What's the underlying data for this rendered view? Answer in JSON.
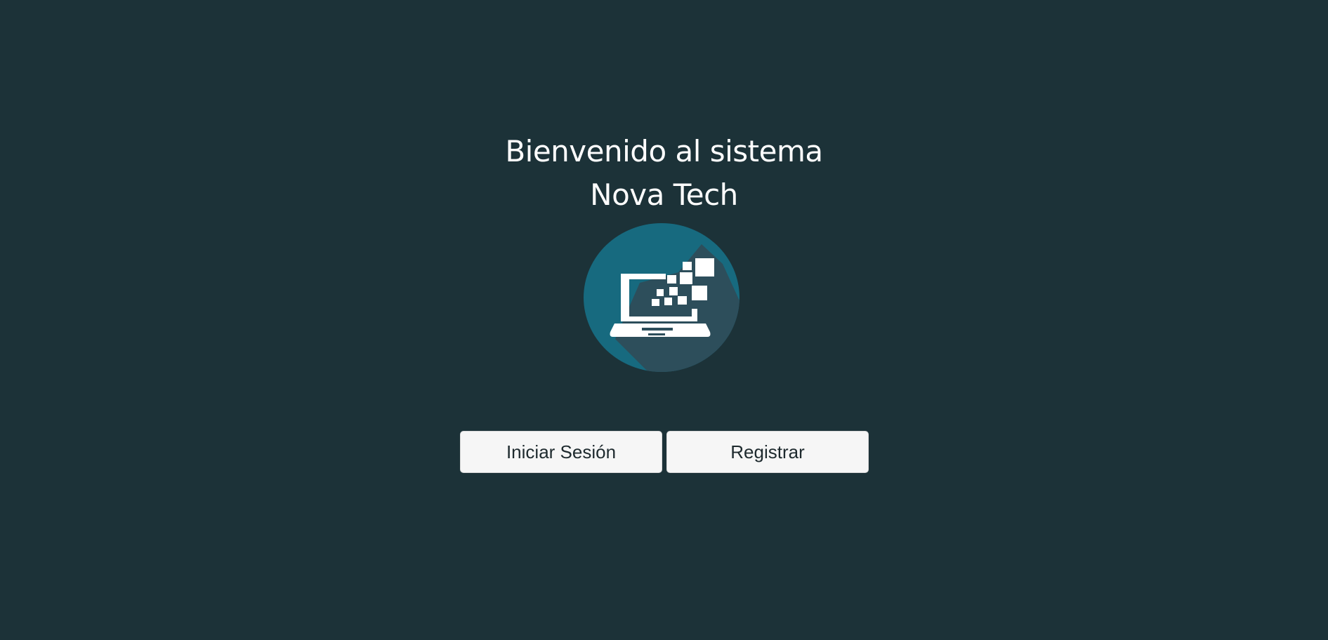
{
  "welcome": {
    "line1": "Bienvenido al sistema",
    "line2": "Nova Tech"
  },
  "logo": {
    "icon": "laptop-pixels-icon",
    "circle_color": "#176a7f",
    "shadow_color": "#2d4e5b",
    "glyph_color": "#ffffff"
  },
  "actions": {
    "login_label": "Iniciar Sesión",
    "register_label": "Registrar"
  },
  "colors": {
    "background": "#1c3238",
    "button_background": "#f6f6f6",
    "button_text": "#1e2a2e"
  }
}
